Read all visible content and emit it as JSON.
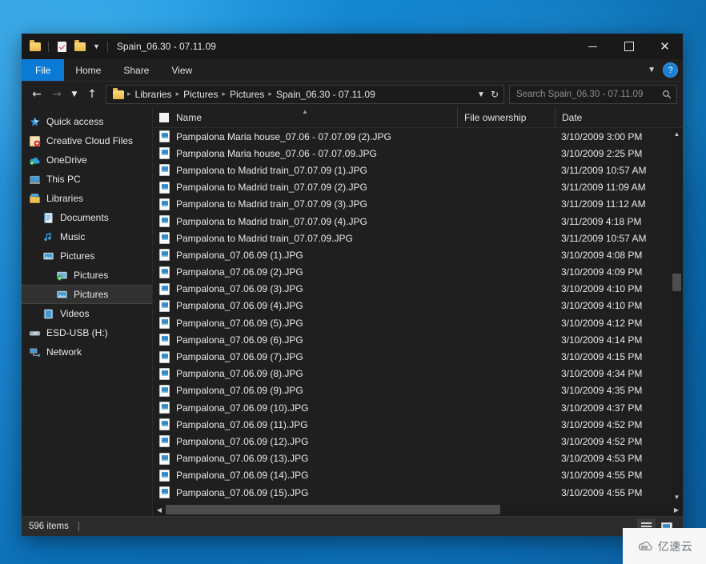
{
  "window": {
    "title": "Spain_06.30 - 07.11.09",
    "quick_access": [
      "folder-icon",
      "properties-icon",
      "new-folder-icon",
      "customize-chevron-icon"
    ],
    "controls": {
      "minimize": "minimize-icon",
      "maximize": "maximize-icon",
      "close": "close-icon"
    }
  },
  "ribbon": {
    "tabs": [
      {
        "label": "File",
        "active": true
      },
      {
        "label": "Home",
        "active": false
      },
      {
        "label": "Share",
        "active": false
      },
      {
        "label": "View",
        "active": false
      }
    ],
    "expand_icon": "chevron-down-icon",
    "help_label": "?"
  },
  "address": {
    "back_icon": "arrow-left-icon",
    "forward_icon": "arrow-right-icon",
    "recent_icon": "chevron-down-icon",
    "up_icon": "arrow-up-icon",
    "folder_icon": "folder-icon",
    "breadcrumbs": [
      "Libraries",
      "Pictures",
      "Pictures",
      "Spain_06.30 - 07.11.09"
    ],
    "dropdown_icon": "chevron-down-icon",
    "refresh_icon": "refresh-icon"
  },
  "search": {
    "placeholder": "Search Spain_06.30 - 07.11.09",
    "value": "",
    "icon": "search-icon"
  },
  "sidebar": {
    "items": [
      {
        "label": "Quick access",
        "icon": "star-icon",
        "indent": 0,
        "selected": false
      },
      {
        "label": "Creative Cloud Files",
        "icon": "creative-cloud-icon",
        "indent": 0,
        "selected": false
      },
      {
        "label": "OneDrive",
        "icon": "onedrive-cloud-icon",
        "indent": 0,
        "selected": false
      },
      {
        "label": "This PC",
        "icon": "computer-icon",
        "indent": 0,
        "selected": false
      },
      {
        "label": "Libraries",
        "icon": "libraries-icon",
        "indent": 0,
        "selected": false
      },
      {
        "label": "Documents",
        "icon": "documents-icon",
        "indent": 1,
        "selected": false
      },
      {
        "label": "Music",
        "icon": "music-icon",
        "indent": 1,
        "selected": false
      },
      {
        "label": "Pictures",
        "icon": "pictures-icon",
        "indent": 1,
        "selected": false
      },
      {
        "label": "Pictures",
        "icon": "pictures-sync-icon",
        "indent": 2,
        "selected": false
      },
      {
        "label": "Pictures",
        "icon": "pictures-icon",
        "indent": 2,
        "selected": true
      },
      {
        "label": "Videos",
        "icon": "videos-icon",
        "indent": 1,
        "selected": false
      },
      {
        "label": "ESD-USB (H:)",
        "icon": "usb-drive-icon",
        "indent": 0,
        "selected": false
      },
      {
        "label": "Network",
        "icon": "network-icon",
        "indent": 0,
        "selected": false
      }
    ]
  },
  "file_list": {
    "columns": [
      {
        "key": "name",
        "label": "Name"
      },
      {
        "key": "owner",
        "label": "File ownership"
      },
      {
        "key": "date",
        "label": "Date"
      }
    ],
    "sort_indicator": "sort-ascending-icon",
    "select_all_checkbox": false,
    "rows": [
      {
        "name": "Pampalona Maria house_07.06 - 07.07.09 (2).JPG",
        "owner": "",
        "date": "3/10/2009 3:00 PM"
      },
      {
        "name": "Pampalona Maria house_07.06 - 07.07.09.JPG",
        "owner": "",
        "date": "3/10/2009 2:25 PM"
      },
      {
        "name": "Pampalona to Madrid train_07.07.09 (1).JPG",
        "owner": "",
        "date": "3/11/2009 10:57 AM"
      },
      {
        "name": "Pampalona to Madrid train_07.07.09 (2).JPG",
        "owner": "",
        "date": "3/11/2009 11:09 AM"
      },
      {
        "name": "Pampalona to Madrid train_07.07.09 (3).JPG",
        "owner": "",
        "date": "3/11/2009 11:12 AM"
      },
      {
        "name": "Pampalona to Madrid train_07.07.09 (4).JPG",
        "owner": "",
        "date": "3/11/2009 4:18 PM"
      },
      {
        "name": "Pampalona to Madrid train_07.07.09.JPG",
        "owner": "",
        "date": "3/11/2009 10:57 AM"
      },
      {
        "name": "Pampalona_07.06.09 (1).JPG",
        "owner": "",
        "date": "3/10/2009 4:08 PM"
      },
      {
        "name": "Pampalona_07.06.09 (2).JPG",
        "owner": "",
        "date": "3/10/2009 4:09 PM"
      },
      {
        "name": "Pampalona_07.06.09 (3).JPG",
        "owner": "",
        "date": "3/10/2009 4:10 PM"
      },
      {
        "name": "Pampalona_07.06.09 (4).JPG",
        "owner": "",
        "date": "3/10/2009 4:10 PM"
      },
      {
        "name": "Pampalona_07.06.09 (5).JPG",
        "owner": "",
        "date": "3/10/2009 4:12 PM"
      },
      {
        "name": "Pampalona_07.06.09 (6).JPG",
        "owner": "",
        "date": "3/10/2009 4:14 PM"
      },
      {
        "name": "Pampalona_07.06.09 (7).JPG",
        "owner": "",
        "date": "3/10/2009 4:15 PM"
      },
      {
        "name": "Pampalona_07.06.09 (8).JPG",
        "owner": "",
        "date": "3/10/2009 4:34 PM"
      },
      {
        "name": "Pampalona_07.06.09 (9).JPG",
        "owner": "",
        "date": "3/10/2009 4:35 PM"
      },
      {
        "name": "Pampalona_07.06.09 (10).JPG",
        "owner": "",
        "date": "3/10/2009 4:37 PM"
      },
      {
        "name": "Pampalona_07.06.09 (11).JPG",
        "owner": "",
        "date": "3/10/2009 4:52 PM"
      },
      {
        "name": "Pampalona_07.06.09 (12).JPG",
        "owner": "",
        "date": "3/10/2009 4:52 PM"
      },
      {
        "name": "Pampalona_07.06.09 (13).JPG",
        "owner": "",
        "date": "3/10/2009 4:53 PM"
      },
      {
        "name": "Pampalona_07.06.09 (14).JPG",
        "owner": "",
        "date": "3/10/2009 4:55 PM"
      },
      {
        "name": "Pampalona_07.06.09 (15).JPG",
        "owner": "",
        "date": "3/10/2009 4:55 PM"
      }
    ]
  },
  "scrollbars": {
    "vertical": {
      "up_icon": "chevron-up-icon",
      "down_icon": "chevron-down-icon"
    },
    "horizontal": {
      "left_icon": "chevron-left-icon",
      "right_icon": "chevron-right-icon"
    }
  },
  "status": {
    "item_count": "596 items",
    "view_details_icon": "details-view-icon",
    "view_thumbnails_icon": "thumbnails-view-icon"
  },
  "watermark": {
    "text": "亿速云",
    "icon": "cloud-logo-icon"
  },
  "colors": {
    "accent": "#0a7ad4",
    "window_bg": "#1f1f1f",
    "titlebar_bg": "#191919",
    "desktop_blue": "#0f7cc8",
    "text": "#e8e8e8"
  }
}
